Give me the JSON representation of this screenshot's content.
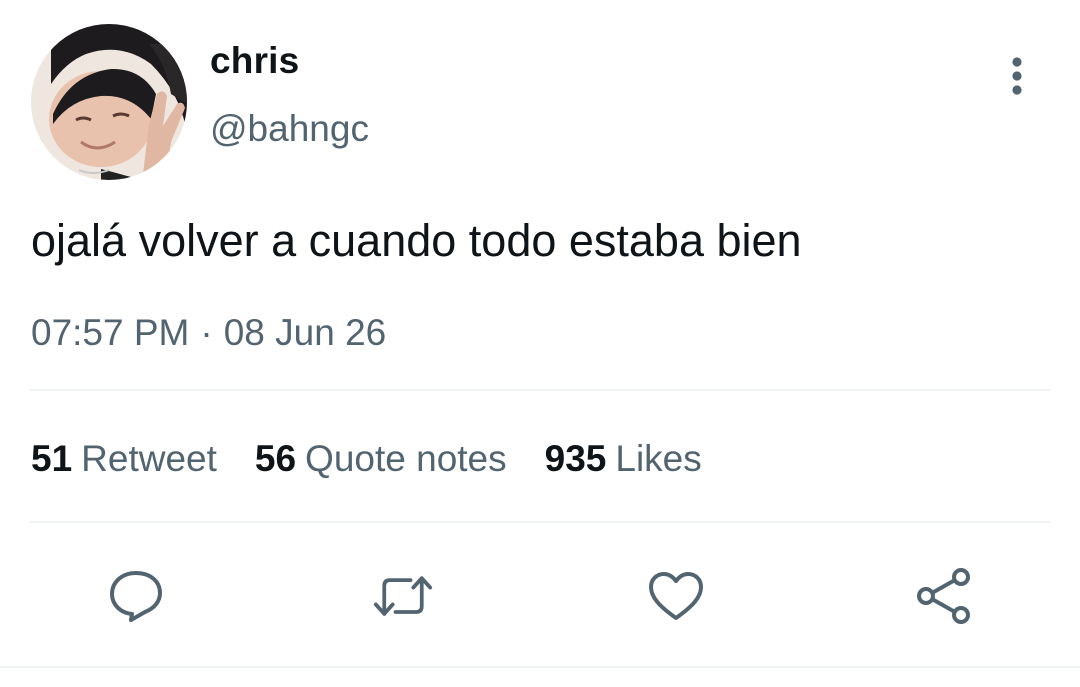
{
  "tweet": {
    "display_name": "chris",
    "handle": "@bahngc",
    "text": "ojalá volver a cuando todo estaba bien",
    "time": "07:57 PM",
    "separator": "·",
    "date": "08 Jun 26",
    "stats": [
      {
        "count": "51",
        "label": "Retweet"
      },
      {
        "count": "56",
        "label": "Quote notes"
      },
      {
        "count": "935",
        "label": "Likes"
      }
    ]
  },
  "icons": {
    "more": "more-vertical-icon",
    "reply": "reply-icon",
    "retweet": "retweet-icon",
    "like": "heart-icon",
    "share": "share-icon"
  },
  "colors": {
    "text": "#0f1419",
    "secondary": "#536471",
    "divider": "#eff3f4"
  }
}
